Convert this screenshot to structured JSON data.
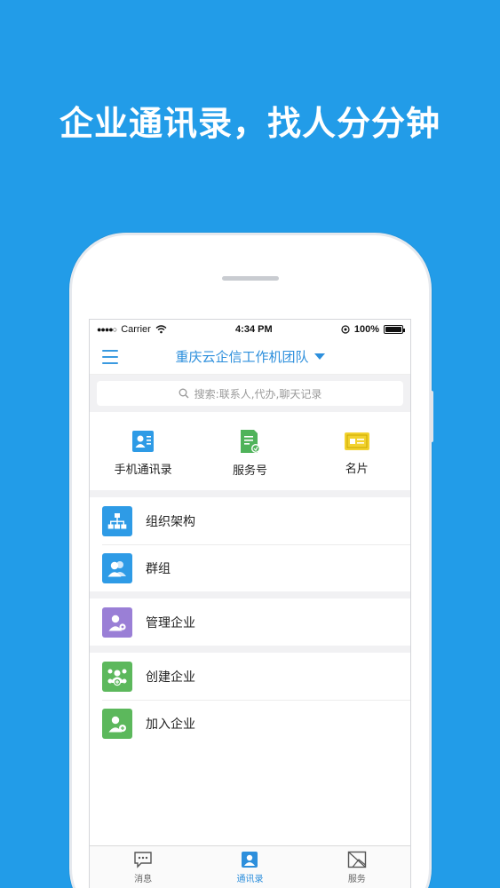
{
  "headline": "企业通讯录，找人分分钟",
  "status_bar": {
    "carrier": "Carrier",
    "time": "4:34 PM",
    "battery": "100%"
  },
  "navbar": {
    "title": "重庆云企信工作机团队"
  },
  "search": {
    "placeholder": "搜索:联系人,代办,聊天记录"
  },
  "quick_actions": [
    {
      "label": "手机通讯录",
      "icon": "phone-contacts-icon",
      "color": "#2e9be6"
    },
    {
      "label": "服务号",
      "icon": "service-account-icon",
      "color": "#4fb35a"
    },
    {
      "label": "名片",
      "icon": "business-card-icon",
      "color": "#f2d22e"
    }
  ],
  "section1": [
    {
      "label": "组织架构",
      "icon": "org-chart-icon",
      "color": "#2e9be6"
    },
    {
      "label": "群组",
      "icon": "group-icon",
      "color": "#2e9be6"
    }
  ],
  "section2": [
    {
      "label": "管理企业",
      "icon": "manage-company-icon",
      "color": "#9a7fd6"
    }
  ],
  "section3": [
    {
      "label": "创建企业",
      "icon": "create-company-icon",
      "color": "#5cb85c"
    },
    {
      "label": "加入企业",
      "icon": "join-company-icon",
      "color": "#5cb85c"
    }
  ],
  "tabbar": [
    {
      "label": "消息",
      "icon": "message-icon",
      "active": false
    },
    {
      "label": "通讯录",
      "icon": "contacts-icon",
      "active": true
    },
    {
      "label": "服务",
      "icon": "service-icon",
      "active": false
    }
  ],
  "colors": {
    "background": "#229ce8",
    "accent": "#2d8fdc"
  }
}
